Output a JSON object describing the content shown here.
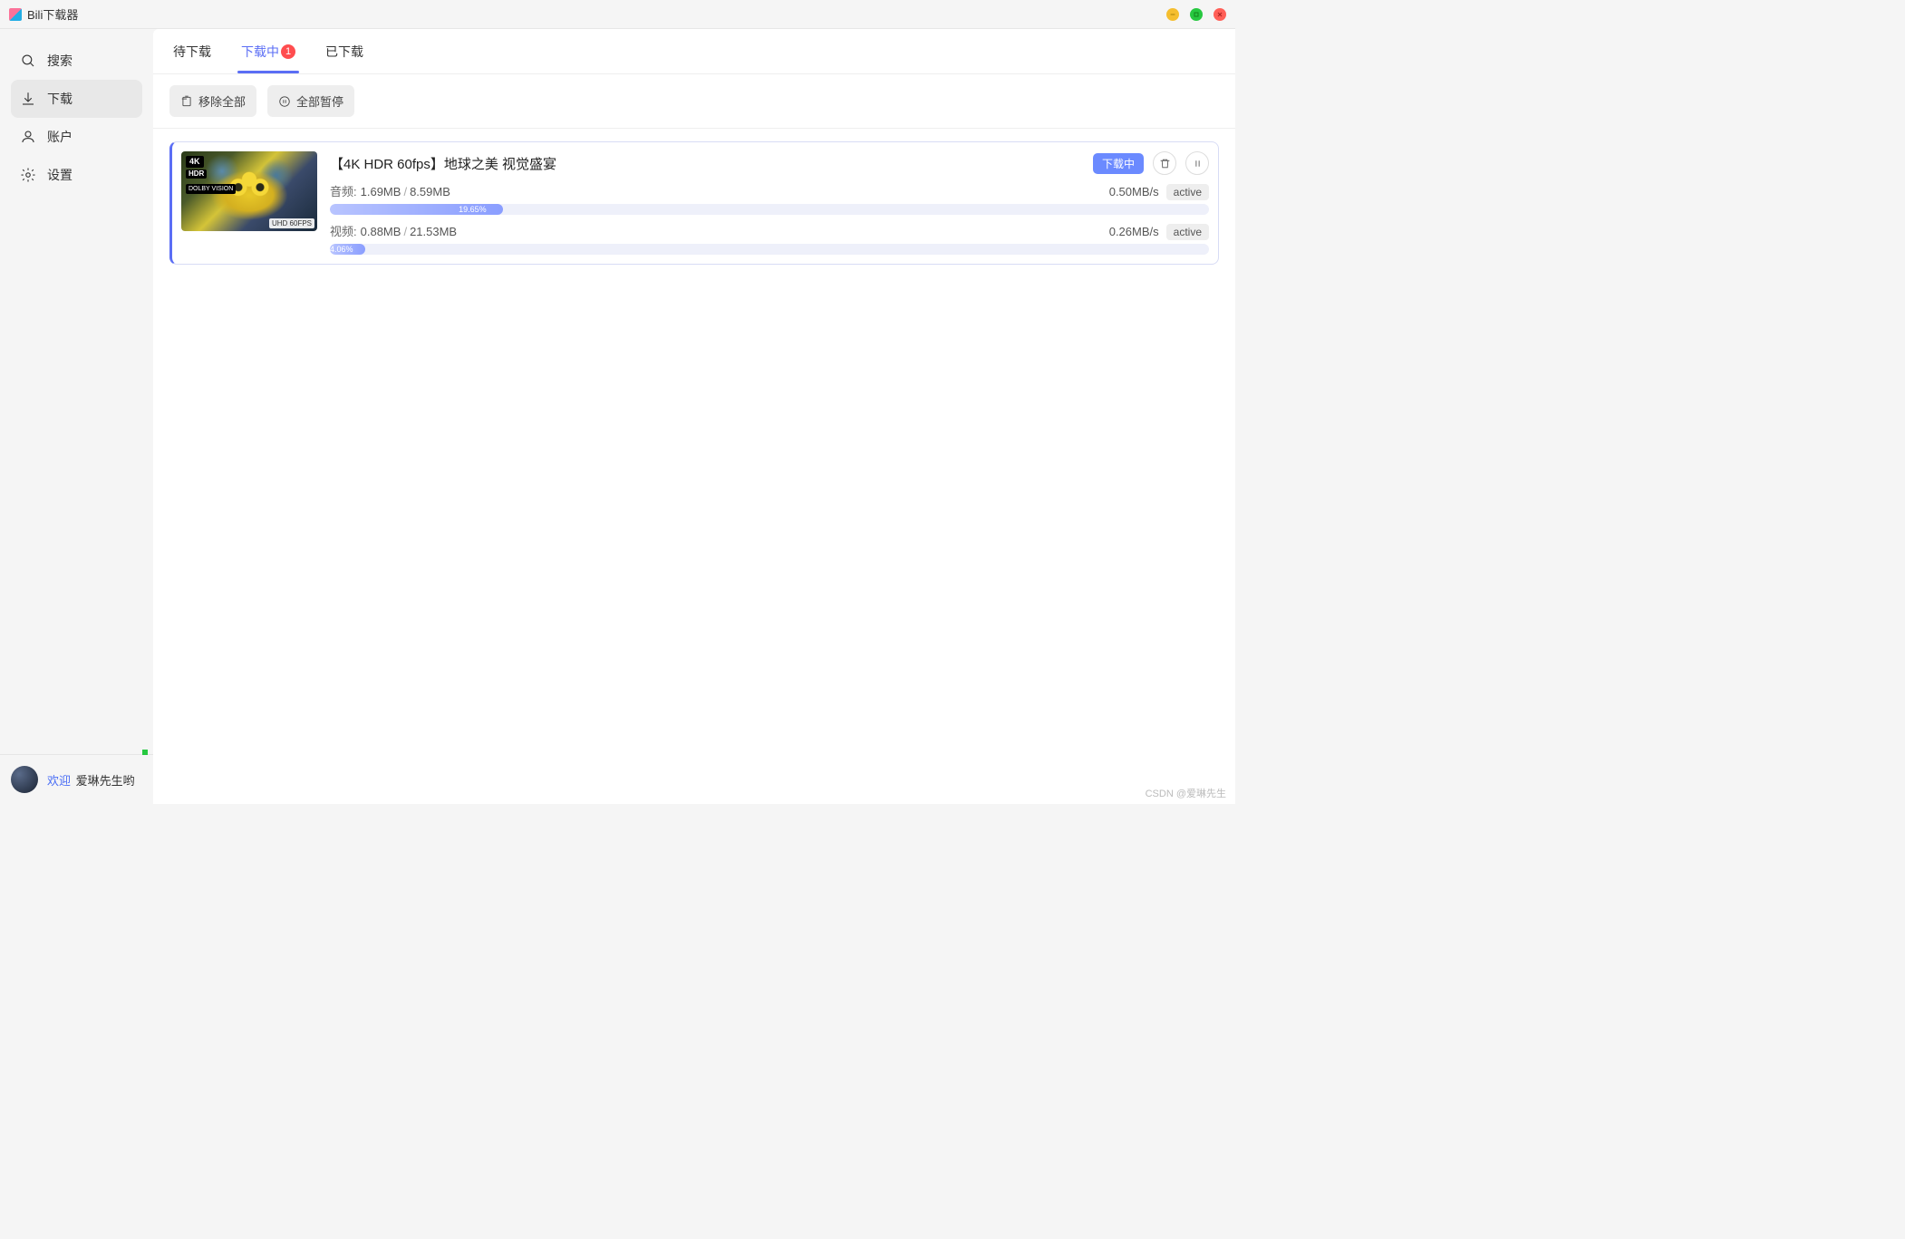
{
  "window": {
    "title": "Bili下载器"
  },
  "sidebar": {
    "items": [
      {
        "label": "搜索",
        "icon": "search"
      },
      {
        "label": "下载",
        "icon": "download",
        "active": true
      },
      {
        "label": "账户",
        "icon": "user"
      },
      {
        "label": "设置",
        "icon": "gear"
      }
    ],
    "footer": {
      "greeting": "欢迎",
      "username": "爱琳先生哟"
    }
  },
  "tabs": [
    {
      "label": "待下载",
      "active": false
    },
    {
      "label": "下载中",
      "active": true,
      "badge": "1"
    },
    {
      "label": "已下载",
      "active": false
    }
  ],
  "toolbar": {
    "remove_all": "移除全部",
    "pause_all": "全部暂停"
  },
  "downloads": [
    {
      "title": "【4K HDR 60fps】地球之美 视觉盛宴",
      "status_chip": "下载中",
      "thumb_tags": {
        "k4": "4K",
        "hdr": "HDR",
        "dv": "DOLBY VISION",
        "fps": "UHD 60FPS"
      },
      "tracks": [
        {
          "label": "音频:",
          "done": "1.69MB",
          "total": "8.59MB",
          "speed": "0.50MB/s",
          "state": "active",
          "percent": "19.65%",
          "width": 19.65
        },
        {
          "label": "视频:",
          "done": "0.88MB",
          "total": "21.53MB",
          "speed": "0.26MB/s",
          "state": "active",
          "percent": "4.06%",
          "width": 4.06
        }
      ]
    }
  ],
  "watermark": "CSDN @爱琳先生"
}
